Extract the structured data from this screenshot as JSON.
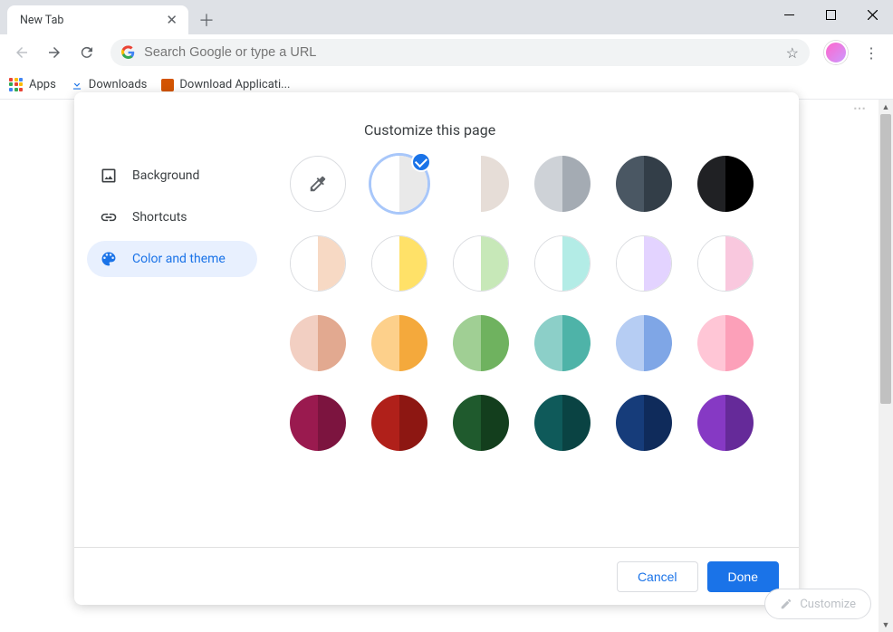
{
  "window": {
    "tab_title": "New Tab"
  },
  "omnibox": {
    "placeholder": "Search Google or type a URL"
  },
  "bookmarks": {
    "apps": "Apps",
    "downloads": "Downloads",
    "download_app": "Download Applicati..."
  },
  "dialog": {
    "title": "Customize this page",
    "sidebar": {
      "background": "Background",
      "shortcuts": "Shortcuts",
      "color_theme": "Color and theme"
    },
    "footer": {
      "cancel": "Cancel",
      "done": "Done"
    },
    "selected_index": 1,
    "swatches": [
      {
        "type": "eyedropper",
        "left": "#ffffff",
        "right": "#ffffff"
      },
      {
        "left": "#ffffff",
        "right": "#e9e9e9",
        "selected": true
      },
      {
        "left": "#ffffff",
        "right": "#e6ddd7"
      },
      {
        "left": "#ced2d7",
        "right": "#a4abb3"
      },
      {
        "left": "#4a5763",
        "right": "#333e48"
      },
      {
        "left": "#202124",
        "right": "#000000"
      },
      {
        "left": "#ffffff",
        "right": "#f7d9c4",
        "bordered": true
      },
      {
        "left": "#ffffff",
        "right": "#ffe168",
        "bordered": true
      },
      {
        "left": "#ffffff",
        "right": "#c7e8b8",
        "bordered": true
      },
      {
        "left": "#ffffff",
        "right": "#b3ece6",
        "bordered": true
      },
      {
        "left": "#ffffff",
        "right": "#e3d3ff",
        "bordered": true
      },
      {
        "left": "#ffffff",
        "right": "#f9c8de",
        "bordered": true
      },
      {
        "left": "#f2cfc2",
        "right": "#e2a990"
      },
      {
        "left": "#fdd08b",
        "right": "#f4a93c"
      },
      {
        "left": "#a0cf94",
        "right": "#6fb25f"
      },
      {
        "left": "#8ccfc8",
        "right": "#4eb3a8"
      },
      {
        "left": "#b6cdf3",
        "right": "#7fa6e6"
      },
      {
        "left": "#ffc6d6",
        "right": "#fca0b9"
      },
      {
        "left": "#9a1a4f",
        "right": "#7c143f"
      },
      {
        "left": "#b0201a",
        "right": "#8d1712"
      },
      {
        "left": "#1f5a2d",
        "right": "#133e1d"
      },
      {
        "left": "#0f5a5a",
        "right": "#0a4343"
      },
      {
        "left": "#163c7a",
        "right": "#0f2b5b"
      },
      {
        "left": "#8639c4",
        "right": "#652a99"
      }
    ]
  },
  "customize_chip": "Customize"
}
